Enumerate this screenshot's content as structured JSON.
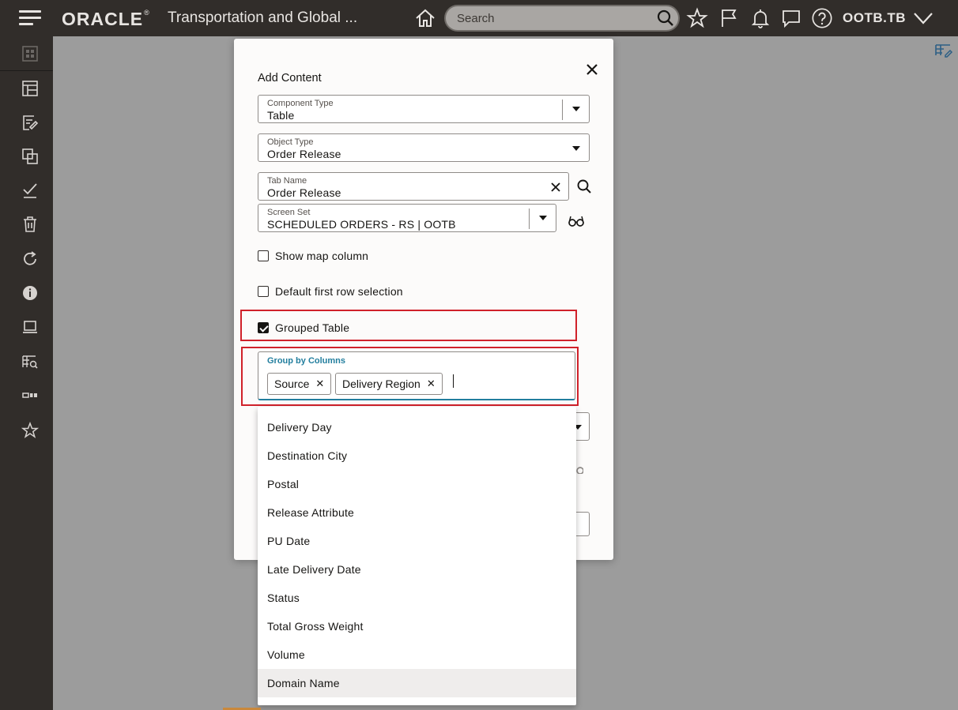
{
  "header": {
    "logo": "ORACLE",
    "logo_mark": "®",
    "app_title": "Transportation and Global ...",
    "search_placeholder": "Search",
    "user": "OOTB.TB"
  },
  "dialog": {
    "title": "Add Content",
    "component_type": {
      "label": "Component Type",
      "value": "Table"
    },
    "object_type": {
      "label": "Object Type",
      "value": "Order Release"
    },
    "tab_name": {
      "label": "Tab Name",
      "value": "Order Release"
    },
    "screen_set": {
      "label": "Screen Set",
      "value": "SCHEDULED ORDERS - RS | OOTB"
    },
    "show_map_column": {
      "label": "Show map column",
      "checked": false
    },
    "default_first_row": {
      "label": "Default first row selection",
      "checked": false
    },
    "grouped_table": {
      "label": "Grouped Table",
      "checked": true
    },
    "group_by": {
      "label": "Group by Columns",
      "chips": [
        "Source",
        "Delivery Region"
      ]
    }
  },
  "dropdown": {
    "options": [
      "Delivery Day",
      "Destination City",
      "Postal",
      "Release Attribute",
      "PU Date",
      "Late Delivery Date",
      "Status",
      "Total Gross Weight",
      "Volume",
      "Domain Name"
    ],
    "hovered_index": 9
  },
  "colors": {
    "header_bg": "#312d2a",
    "highlight": "#d0212a",
    "focus": "#227e9e"
  }
}
